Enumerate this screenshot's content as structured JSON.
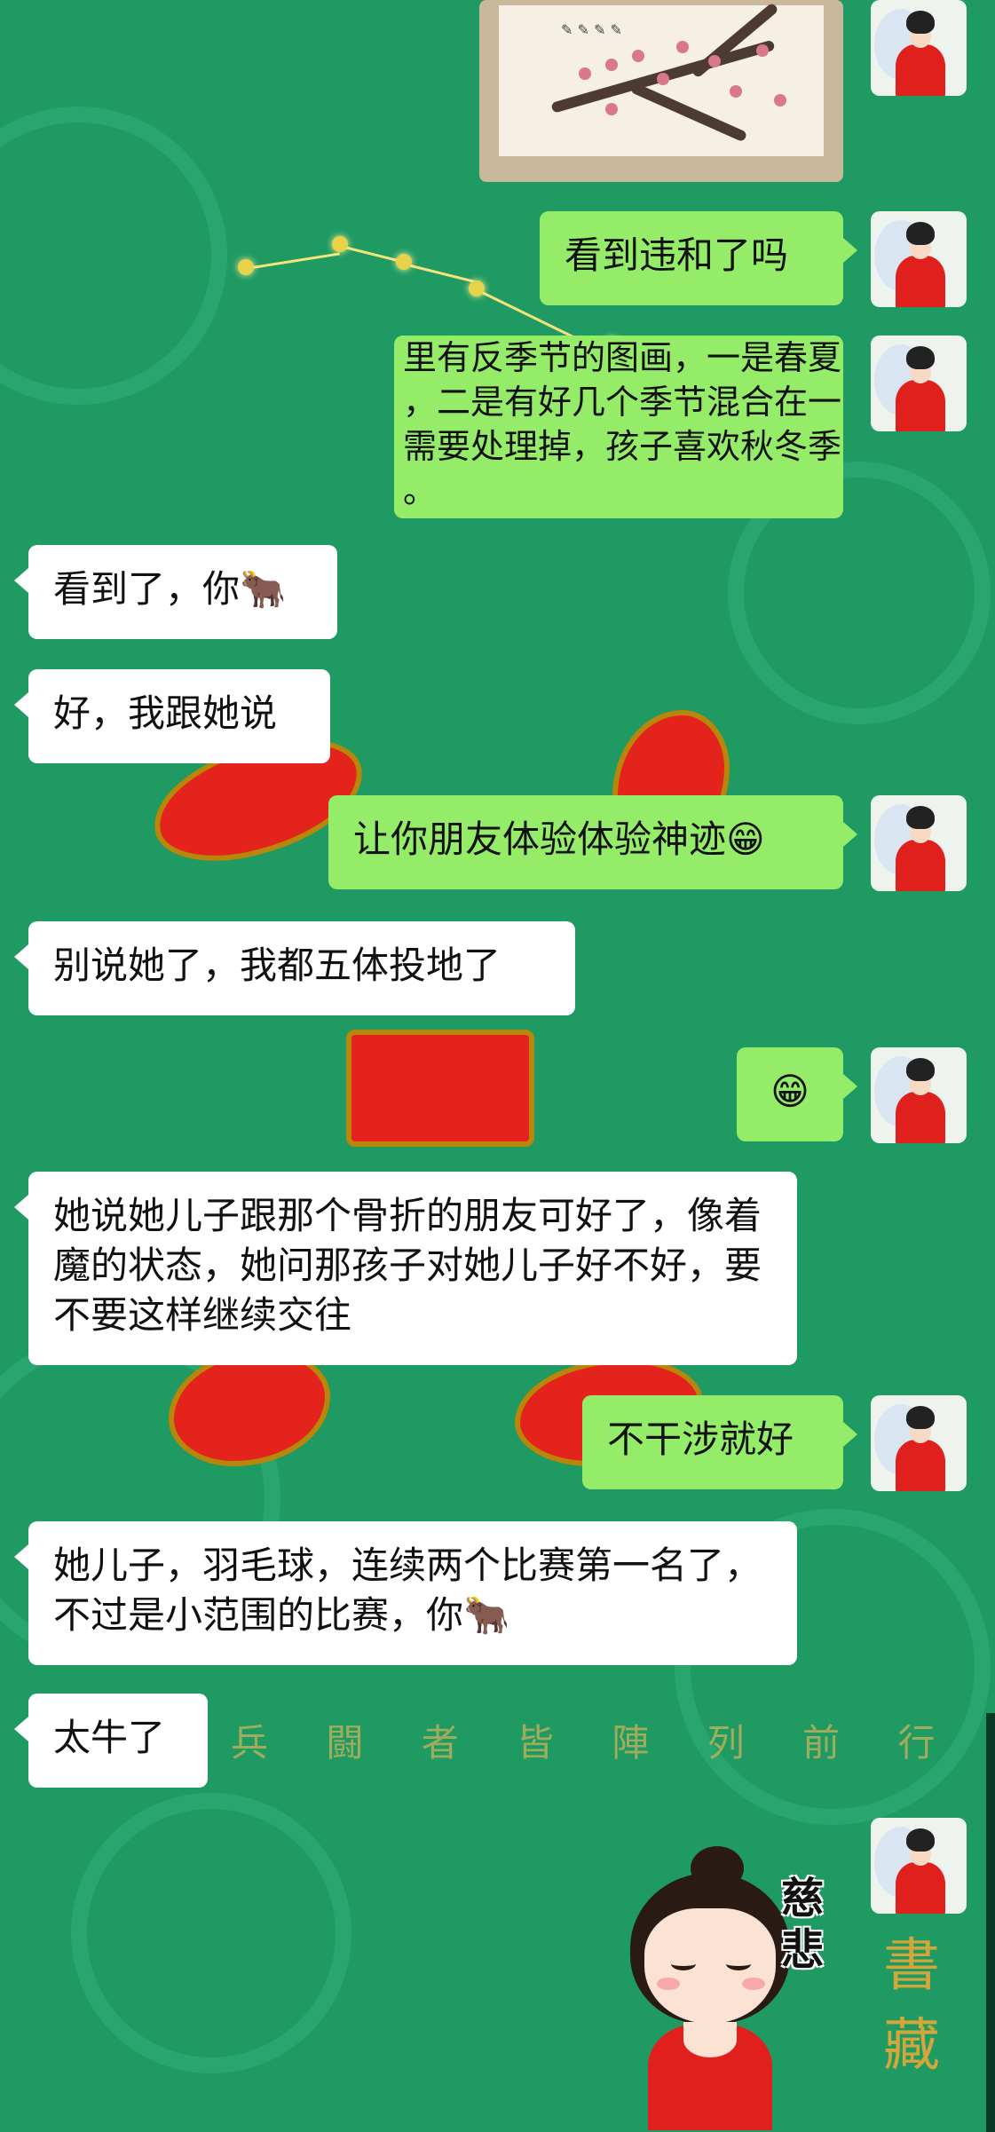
{
  "background": {
    "watermark_line": "兵 闘 者 皆 陣 列 前 行",
    "side_glyphs": "書 藏",
    "colors": {
      "green": "#1f9a62",
      "red": "#e3231c",
      "gold": "#b8860b"
    }
  },
  "messages": [
    {
      "side": "out",
      "type": "image",
      "image_caption": "梅花"
    },
    {
      "side": "out",
      "type": "text",
      "text": "看到违和了吗"
    },
    {
      "side": "out",
      "type": "text",
      "text": "里有反季节的图画，一是春夏\n，二是有好几个季节混合在一\n需要处理掉，孩子喜欢秋冬季\n。"
    },
    {
      "side": "in",
      "type": "text",
      "text": "看到了，你🐂"
    },
    {
      "side": "in",
      "type": "text",
      "text": "好，我跟她说"
    },
    {
      "side": "out",
      "type": "text",
      "text": "让你朋友体验体验神迹😁"
    },
    {
      "side": "in",
      "type": "text",
      "text": "别说她了，我都五体投地了"
    },
    {
      "side": "out",
      "type": "text",
      "text": "😁"
    },
    {
      "side": "in",
      "type": "text",
      "text": "她说她儿子跟那个骨折的朋友可好了，像着魔的状态，她问那孩子对她儿子好不好，要不要这样继续交往"
    },
    {
      "side": "out",
      "type": "text",
      "text": "不干涉就好"
    },
    {
      "side": "in",
      "type": "text",
      "text": "她儿子，羽毛球，连续两个比赛第一名了，不过是小范围的比赛，你🐂"
    },
    {
      "side": "in",
      "type": "text",
      "text": "太牛了"
    },
    {
      "side": "out",
      "type": "sticker",
      "sticker_label": "慈悲"
    }
  ]
}
